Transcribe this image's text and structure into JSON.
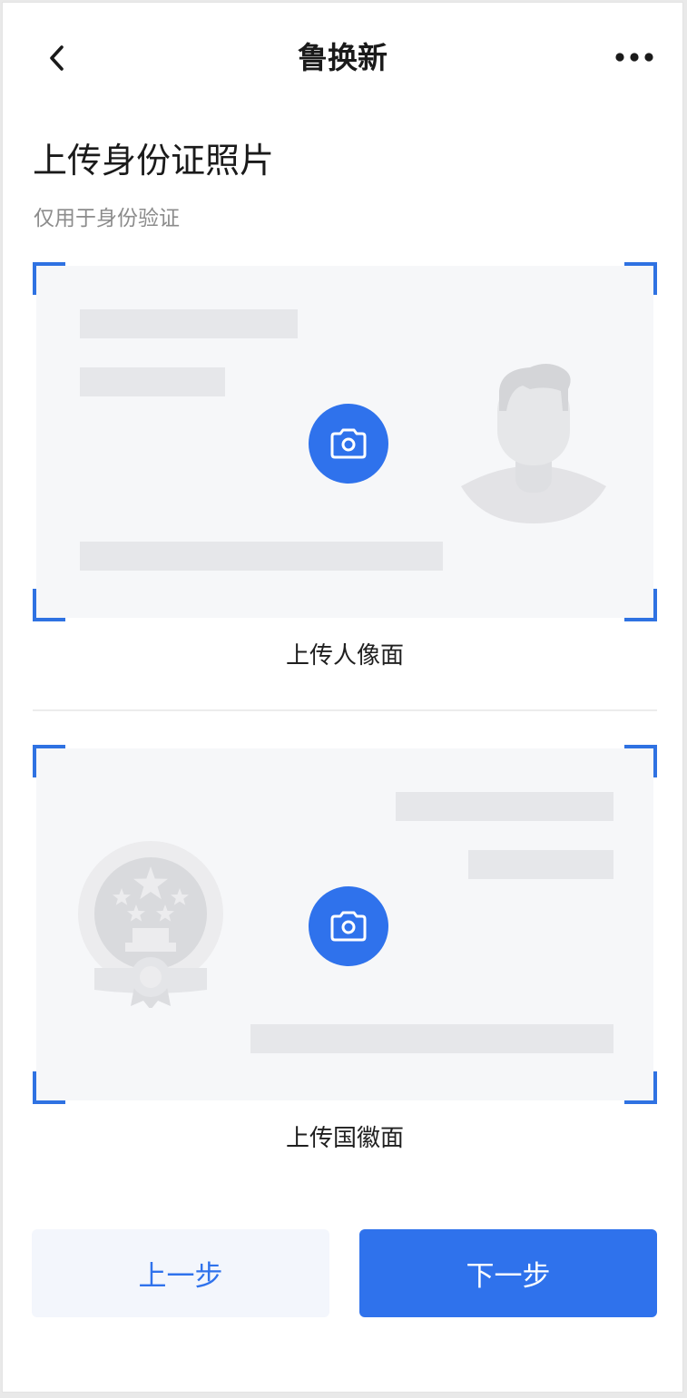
{
  "nav": {
    "title": "鲁换新"
  },
  "page": {
    "heading": "上传身份证照片",
    "subtitle": "仅用于身份验证"
  },
  "cards": {
    "portrait": {
      "label": "上传人像面",
      "illustration": "person-silhouette-icon",
      "action_icon": "camera-icon"
    },
    "emblem": {
      "label": "上传国徽面",
      "illustration": "national-emblem-icon",
      "action_icon": "camera-icon"
    }
  },
  "buttons": {
    "prev_label": "上一步",
    "next_label": "下一步"
  },
  "colors": {
    "accent": "#2f72ec",
    "card_background": "#f6f7f9",
    "placeholder_bar": "#e6e7ea",
    "secondary_button_bg": "#f3f6fc"
  }
}
